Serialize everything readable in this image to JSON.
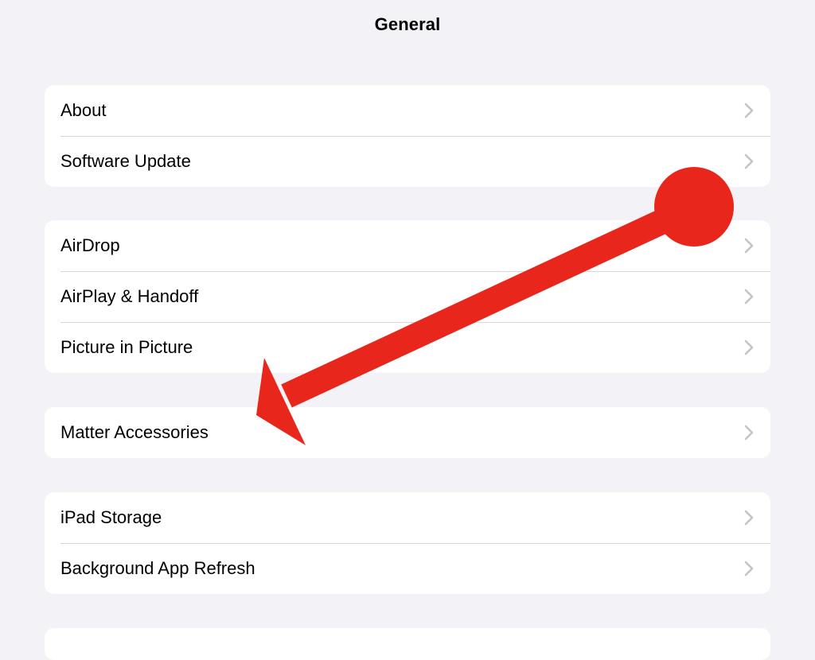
{
  "nav": {
    "title": "General"
  },
  "groups": [
    {
      "items": [
        {
          "label": "About"
        },
        {
          "label": "Software Update"
        }
      ]
    },
    {
      "items": [
        {
          "label": "AirDrop"
        },
        {
          "label": "AirPlay & Handoff"
        },
        {
          "label": "Picture in Picture"
        }
      ]
    },
    {
      "items": [
        {
          "label": "Matter Accessories"
        }
      ]
    },
    {
      "items": [
        {
          "label": "iPad Storage"
        },
        {
          "label": "Background App Refresh"
        }
      ]
    }
  ],
  "icons": {
    "row_disclosure": "chevron-right-icon",
    "annotation": "red-arrow-annotation"
  },
  "colors": {
    "background": "#f2f2f7",
    "cell": "#ffffff",
    "separator": "#d6d6db",
    "chevron": "#c4c4c8",
    "annotation": "#e8261b"
  }
}
